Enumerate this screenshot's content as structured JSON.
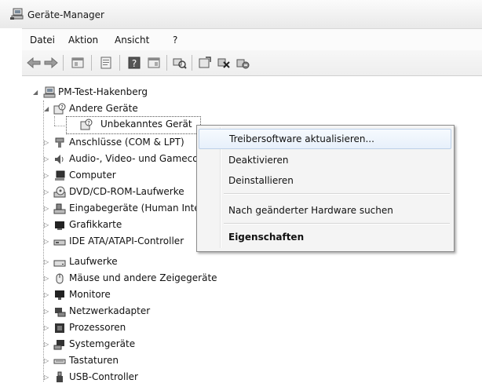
{
  "window": {
    "title": "Geräte-Manager"
  },
  "menu": [
    "Datei",
    "Aktion",
    "Ansicht",
    "?"
  ],
  "toolbar": [
    "back-icon",
    "forward-icon",
    "view-icon",
    "properties-icon",
    "help-icon",
    "view2-icon",
    "scan-icon",
    "update-driver-icon",
    "disable-icon",
    "uninstall-icon"
  ],
  "tree": {
    "root": "PM-Test-Hakenberg",
    "items": [
      "Andere Geräte",
      "Unbekanntes Gerät",
      "Anschlüsse (COM & LPT)",
      "Audio-, Video- und Gamecontroller",
      "Computer",
      "DVD/CD-ROM-Laufwerke",
      "Eingabegeräte (Human Interface Devices)",
      "Grafikkarte",
      "IDE ATA/ATAPI-Controller",
      "Laufwerke",
      "Mäuse und andere Zeigegeräte",
      "Monitore",
      "Netzwerkadapter",
      "Prozessoren",
      "Systemgeräte",
      "Tastaturen",
      "USB-Controller"
    ]
  },
  "context_menu": {
    "update_driver": "Treibersoftware aktualisieren...",
    "disable": "Deaktivieren",
    "uninstall": "Deinstallieren",
    "scan": "Nach geänderter Hardware suchen",
    "properties": "Eigenschaften"
  }
}
